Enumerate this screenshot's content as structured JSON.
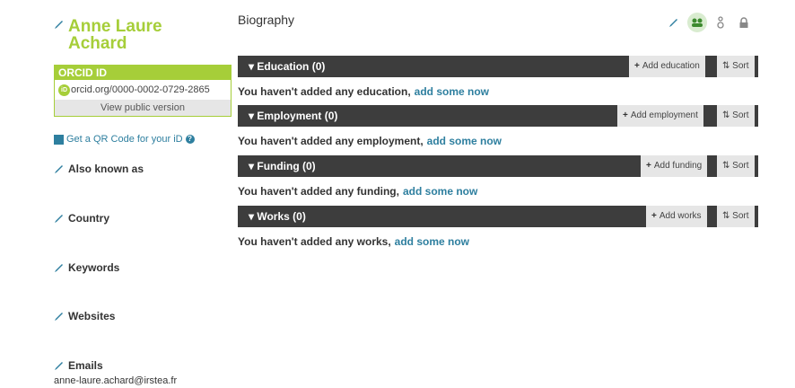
{
  "profile": {
    "name_line1": "Anne Laure",
    "name_line2": "Achard",
    "orcid_header": "ORCID ID",
    "orcid_url": "orcid.org/0000-0002-0729-2865",
    "view_public": "View public version",
    "qr_text": "Get a QR Code for your iD",
    "also_known_as": "Also known as",
    "country": "Country",
    "keywords": "Keywords",
    "websites": "Websites",
    "emails": "Emails",
    "email_value": "anne-laure.achard@irstea.fr"
  },
  "main": {
    "biography": "Biography",
    "sections": [
      {
        "title": "Education (0)",
        "add": "Add education",
        "sort": "Sort",
        "empty_text": "You haven't added any education,",
        "link": "add some now"
      },
      {
        "title": "Employment (0)",
        "add": "Add employment",
        "sort": "Sort",
        "empty_text": "You haven't added any employment,",
        "link": "add some now"
      },
      {
        "title": "Funding (0)",
        "add": "Add funding",
        "sort": "Sort",
        "empty_text": "You haven't added any funding,",
        "link": "add some now"
      },
      {
        "title": "Works (0)",
        "add": "Add works",
        "sort": "Sort",
        "empty_text": "You haven't added any works,",
        "link": "add some now"
      }
    ]
  },
  "icons": {
    "edit": "pencil-icon",
    "privacy_everyone": "group-icon",
    "privacy_trusted": "trusted-icon",
    "privacy_only_me": "lock-icon"
  },
  "colors": {
    "brand_green": "#a6ce39",
    "link_blue": "#2e7f9f",
    "bar_dark": "#3d3d3d"
  }
}
